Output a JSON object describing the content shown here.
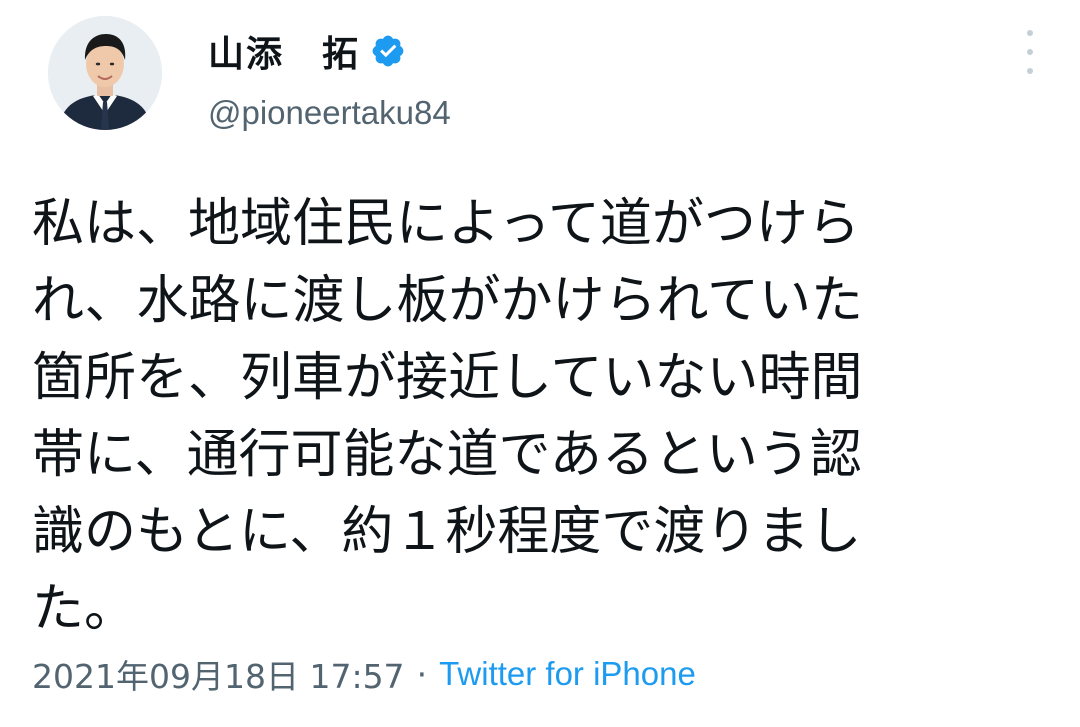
{
  "author": {
    "display_name": "山添　拓",
    "handle": "@pioneertaku84",
    "verified": true,
    "avatar_icon": "avatar-photo"
  },
  "tweet": {
    "lines": [
      "私は、地域住民によって道がつけら",
      "れ、水路に渡し板がかけられていた",
      "箇所を、列車が接近していない時間",
      "帯に、通行可能な道であるという認",
      "識のもとに、約１秒程度で渡りまし",
      "た。"
    ],
    "timestamp": "2021年09月18日 17:57",
    "separator": "·",
    "source": "Twitter for iPhone"
  },
  "icons": {
    "verified": "verified-badge-icon",
    "more": "more-options-icon"
  },
  "colors": {
    "verified_blue": "#1d9bf0",
    "secondary_text": "#536471",
    "link": "#1d9bf0"
  }
}
